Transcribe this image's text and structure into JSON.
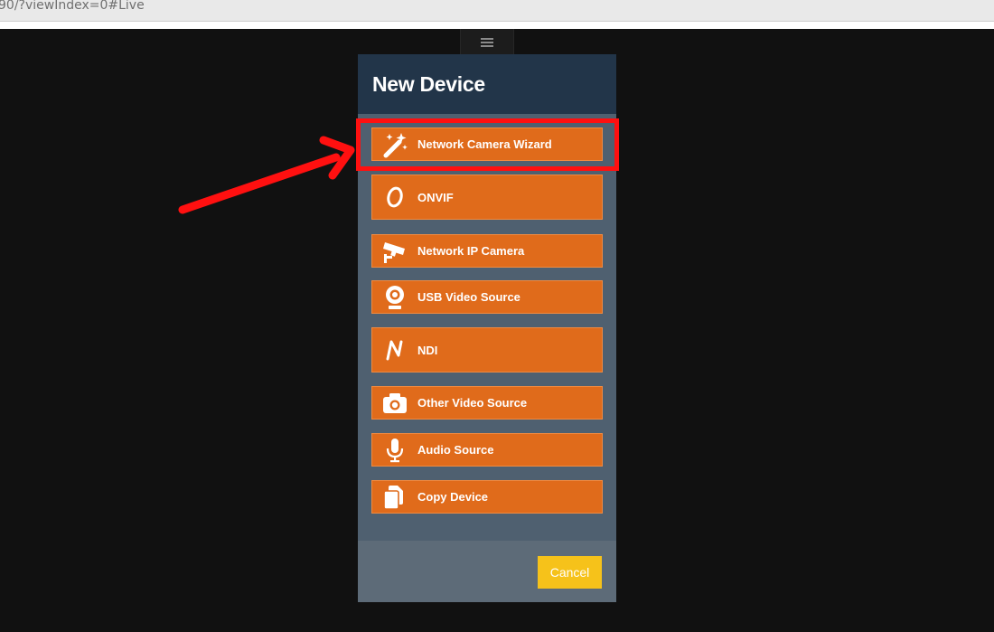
{
  "browser": {
    "url_fragment": "90/?viewIndex=0#Live"
  },
  "dialog": {
    "title": "New Device",
    "items": [
      {
        "label": "Network Camera Wizard",
        "icon": "magic-wand-icon"
      },
      {
        "label": "ONVIF",
        "icon": "onvif-icon"
      },
      {
        "label": "Network IP Camera",
        "icon": "security-camera-icon"
      },
      {
        "label": "USB Video Source",
        "icon": "webcam-icon"
      },
      {
        "label": "NDI",
        "icon": "ndi-icon"
      },
      {
        "label": "Other Video Source",
        "icon": "camera-icon"
      },
      {
        "label": "Audio Source",
        "icon": "microphone-icon"
      },
      {
        "label": "Copy Device",
        "icon": "copy-icon"
      }
    ],
    "cancel_label": "Cancel"
  },
  "colors": {
    "accent_orange": "#e06b1b",
    "header_navy": "#223549",
    "dialog_body": "#4f6070",
    "cancel_yellow": "#f6c21a",
    "annotation_red": "#ff1010"
  }
}
